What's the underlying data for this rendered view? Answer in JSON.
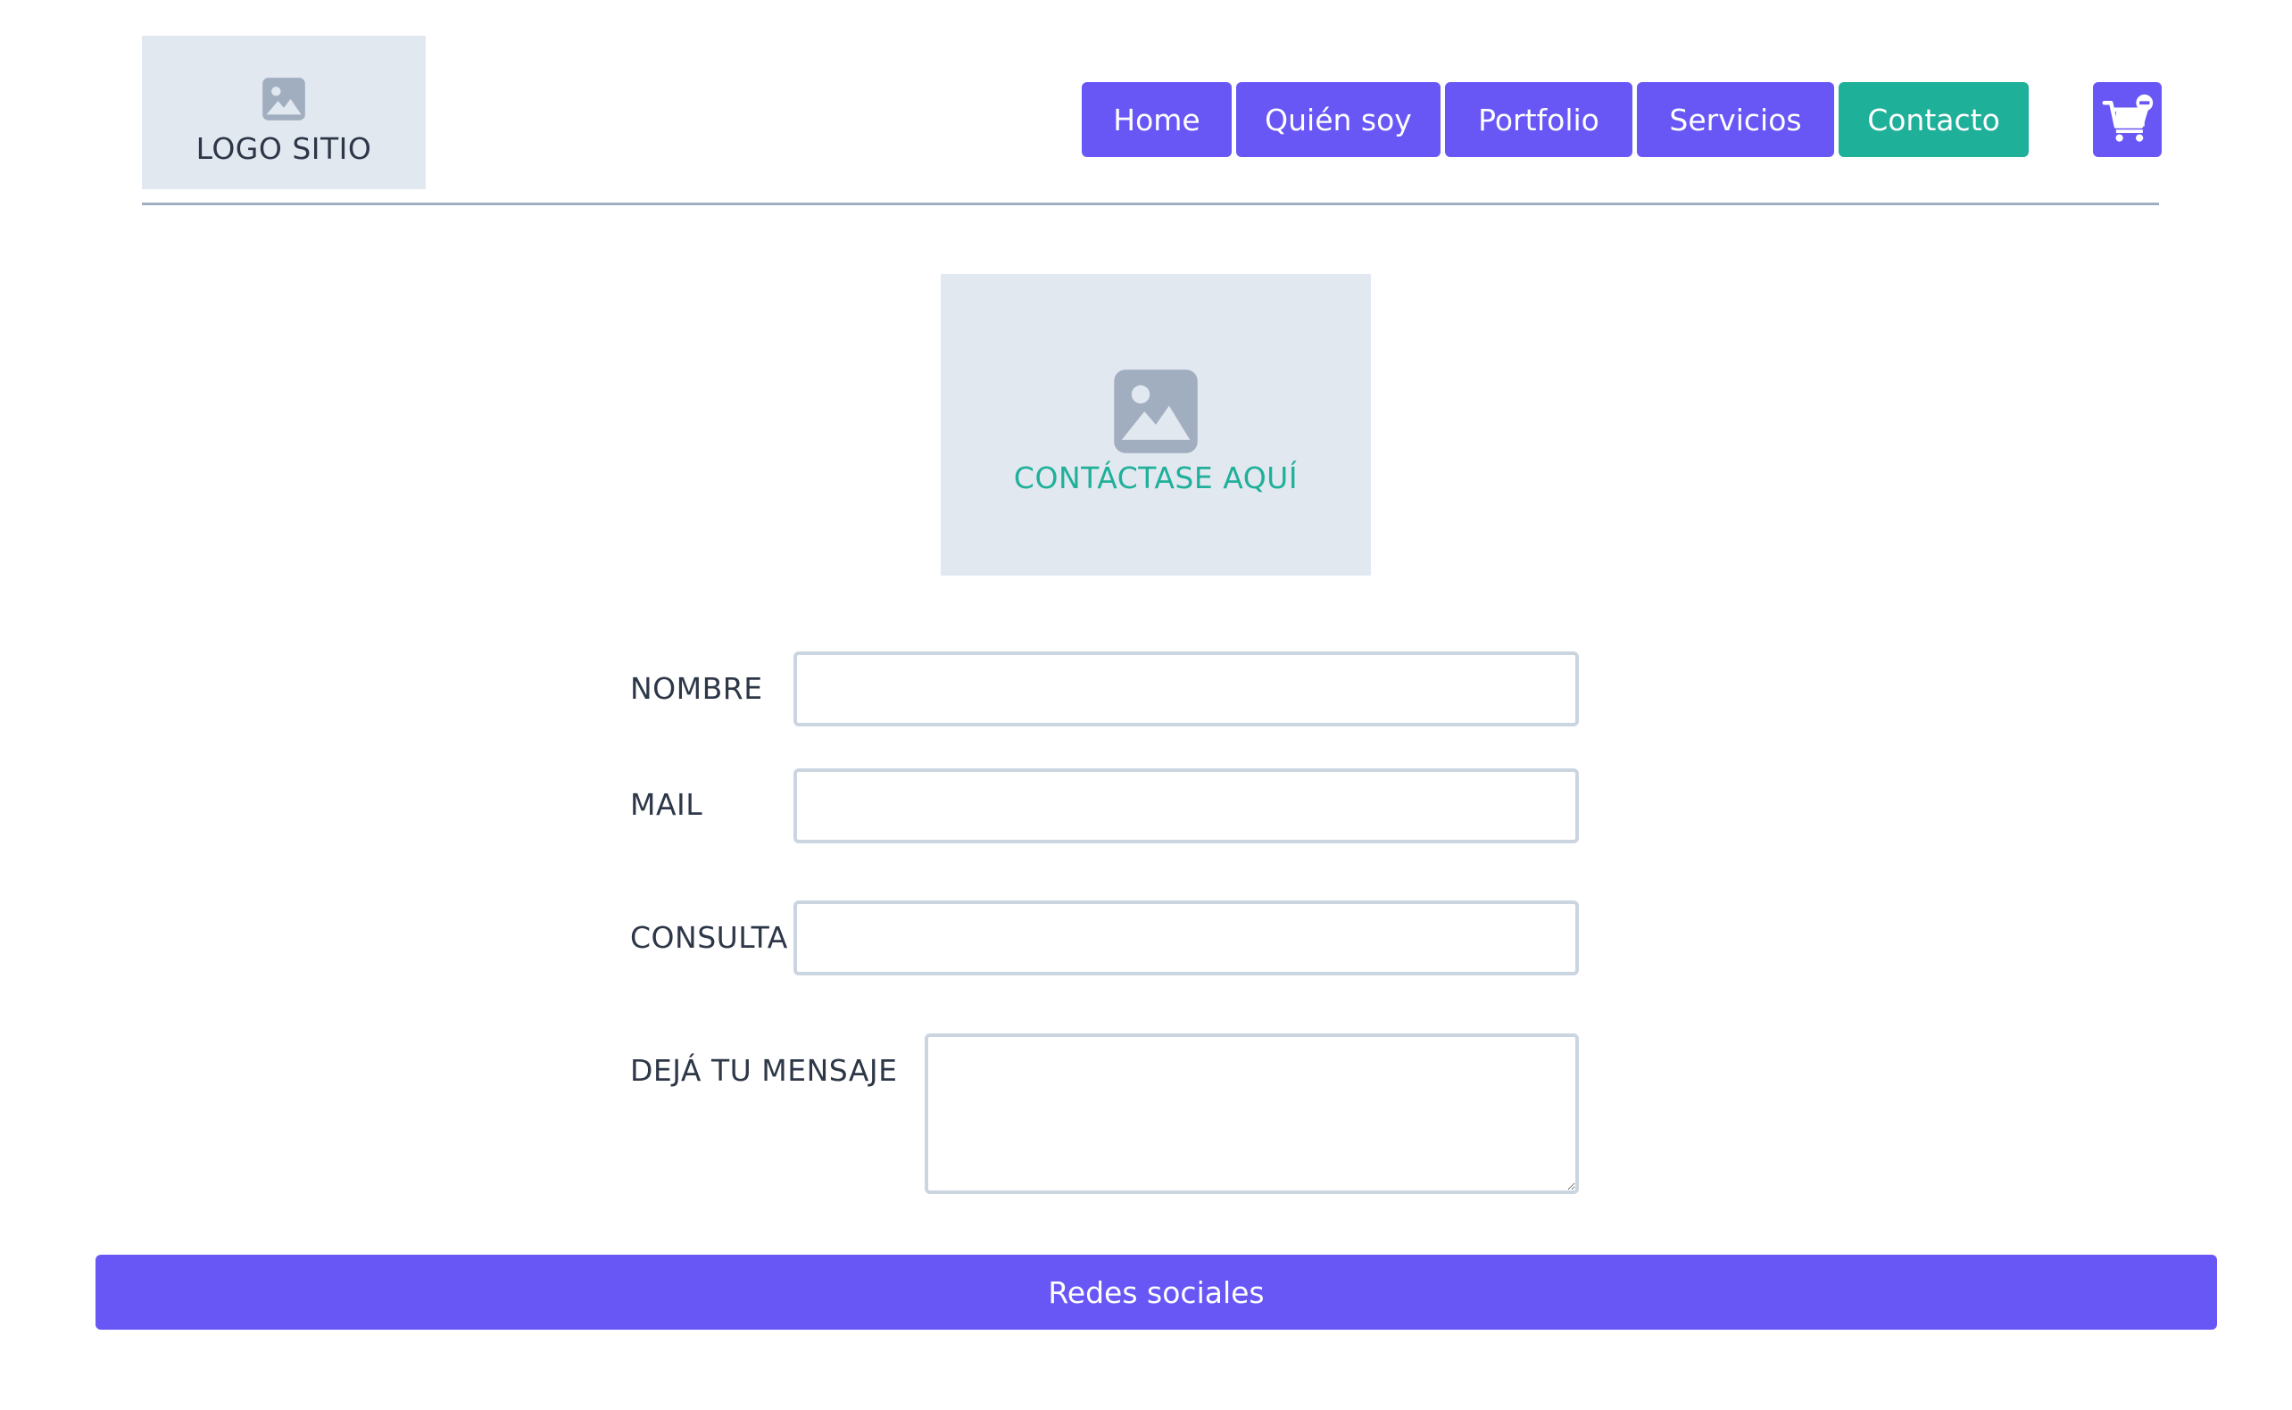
{
  "header": {
    "logo": {
      "text": "LOGO SITIO",
      "icon": "image-placeholder-icon"
    },
    "nav": {
      "items": [
        {
          "label": "Home",
          "active": false
        },
        {
          "label": "Quién soy",
          "active": false
        },
        {
          "label": "Portfolio",
          "active": false
        },
        {
          "label": "Servicios",
          "active": false
        },
        {
          "label": "Contacto",
          "active": true
        }
      ]
    },
    "cart": {
      "icon": "cart-remove-icon"
    }
  },
  "hero": {
    "text": "CONTÁCTASE AQUÍ",
    "icon": "image-placeholder-icon"
  },
  "form": {
    "nombre": {
      "label": "NOMBRE",
      "value": "",
      "placeholder": ""
    },
    "mail": {
      "label": "MAIL",
      "value": "",
      "placeholder": ""
    },
    "consulta": {
      "label": "CONSULTA",
      "value": "",
      "placeholder": ""
    },
    "mensaje": {
      "label": "DEJÁ TU MENSAJE",
      "value": "",
      "placeholder": ""
    }
  },
  "footer": {
    "label": "Redes sociales"
  },
  "colors": {
    "primary": "#6857f5",
    "accent": "#1fb09a",
    "placeholder_bg": "#e2e8f0",
    "border": "#cbd5e0",
    "divider": "#a0aec0",
    "text": "#2d3748"
  }
}
